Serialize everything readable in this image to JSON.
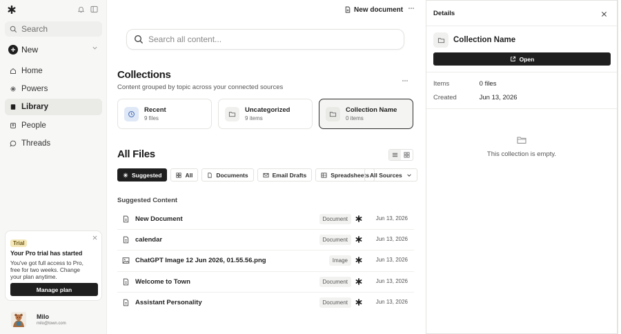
{
  "sidebar": {
    "search_placeholder": "Search",
    "new_label": "New",
    "nav": [
      {
        "label": "Home"
      },
      {
        "label": "Powers"
      },
      {
        "label": "Library"
      },
      {
        "label": "People"
      },
      {
        "label": "Threads"
      }
    ],
    "active_nav": "Library",
    "trial": {
      "badge": "Trial",
      "title": "Your Pro trial has started",
      "body": "You've got full access to Pro, free for two weeks. Change your plan anytime.",
      "button": "Manage plan"
    },
    "user": {
      "name": "Milo",
      "email": "milo@town.com"
    }
  },
  "topbar": {
    "new_document_label": "New document"
  },
  "main": {
    "search_placeholder": "Search all content...",
    "collections": {
      "title": "Collections",
      "subtitle": "Content grouped by topic across your connected sources",
      "cards": [
        {
          "name": "Recent",
          "count": "9 files",
          "icon": "clock-icon"
        },
        {
          "name": "Uncategorized",
          "count": "9 items",
          "icon": "folder-icon"
        },
        {
          "name": "Collection Name",
          "count": "0 items",
          "icon": "folder-icon"
        }
      ]
    },
    "files": {
      "title": "All Files",
      "filters": [
        "Suggested",
        "All",
        "Documents",
        "Email Drafts",
        "Spreadsheets"
      ],
      "active_filter": "Suggested",
      "sources_label": "All Sources",
      "section_label": "Suggested Content",
      "rows": [
        {
          "name": "New Document",
          "type": "Document",
          "date": "Jun 13, 2026",
          "icon": "document-icon"
        },
        {
          "name": "calendar",
          "type": "Document",
          "date": "Jun 13, 2026",
          "icon": "document-icon"
        },
        {
          "name": "ChatGPT Image 12 Jun 2026, 01.55.56.png",
          "type": "Image",
          "date": "Jun 13, 2026",
          "icon": "image-icon"
        },
        {
          "name": "Welcome to Town",
          "type": "Document",
          "date": "Jun 13, 2026",
          "icon": "document-icon"
        },
        {
          "name": "Assistant Personality",
          "type": "Document",
          "date": "Jun 13, 2026",
          "icon": "document-icon"
        }
      ]
    }
  },
  "details": {
    "title": "Details",
    "collection_name": "Collection Name",
    "open_label": "Open",
    "items_label": "Items",
    "items_value": "0 files",
    "created_label": "Created",
    "created_value": "Jun 13, 2026",
    "empty_text": "This collection is empty."
  },
  "colors": {
    "accent_dark": "#1f1f1f",
    "recent_icon_bg": "#dfe8f7",
    "recent_icon": "#4a6fb5",
    "trial_badge": "#f4e7b8"
  }
}
